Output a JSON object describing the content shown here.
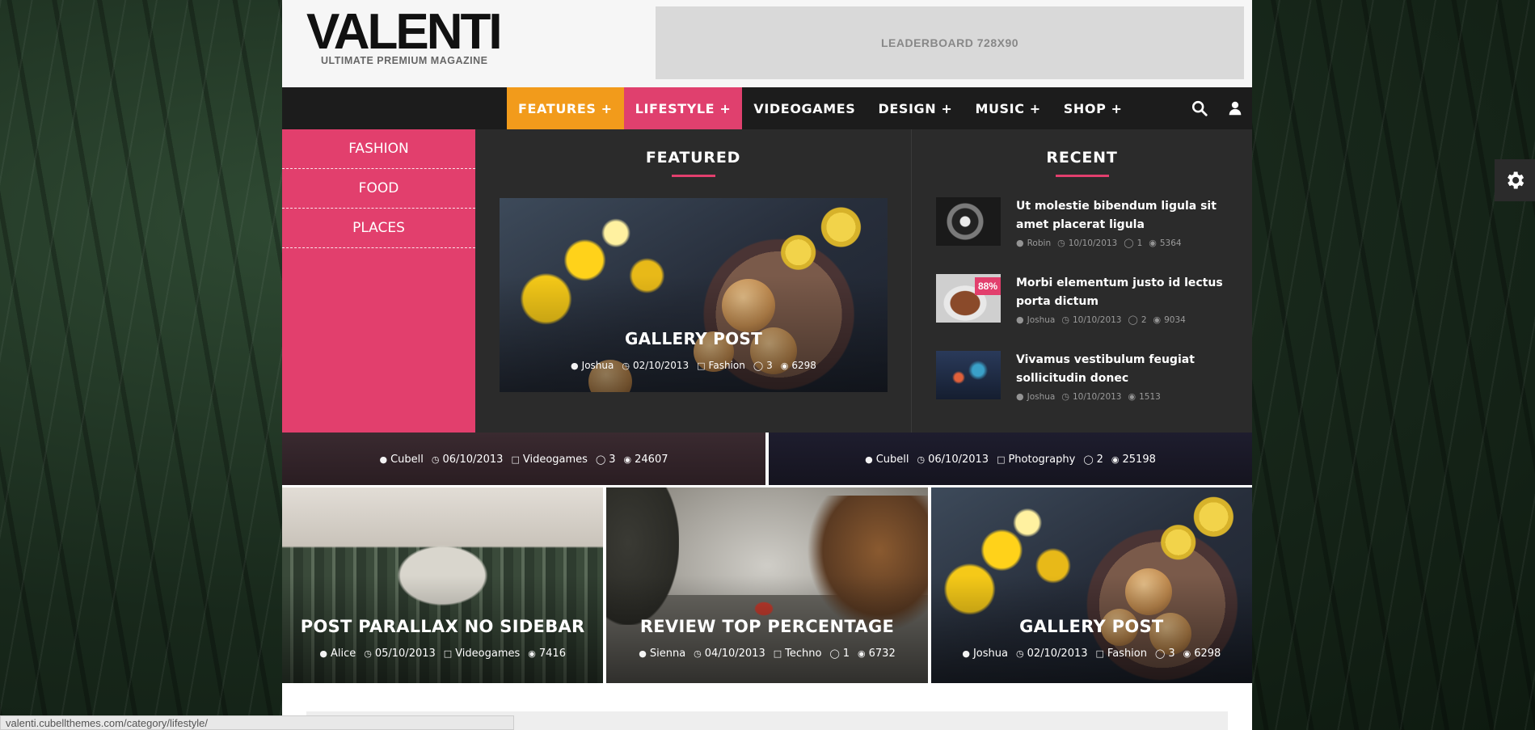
{
  "header": {
    "logo_title": "VALENTI",
    "logo_tagline": "ULTIMATE PREMIUM MAGAZINE",
    "leaderboard": "LEADERBOARD 728X90"
  },
  "nav": {
    "items": [
      {
        "label": "FEATURES +"
      },
      {
        "label": "LIFESTYLE +"
      },
      {
        "label": "VIDEOGAMES"
      },
      {
        "label": "DESIGN +"
      },
      {
        "label": "MUSIC +"
      },
      {
        "label": "SHOP +"
      }
    ],
    "icons": [
      "search-icon",
      "user-icon"
    ],
    "colors": {
      "features": "#f29b1b",
      "lifestyle": "#e0406e",
      "bar": "#1c1c1c"
    }
  },
  "mega_menu": {
    "sub_items": [
      {
        "label": "FASHION"
      },
      {
        "label": "FOOD"
      },
      {
        "label": "PLACES"
      }
    ],
    "featured": {
      "heading": "FEATURED",
      "title": "GALLERY POST",
      "author": "Joshua",
      "date": "02/10/2013",
      "category": "Fashion",
      "comments": "3",
      "views": "6298"
    },
    "recent": {
      "heading": "RECENT",
      "items": [
        {
          "title": "Ut molestie bibendum ligula sit amet placerat ligula",
          "author": "Robin",
          "date": "10/10/2013",
          "comments": "1",
          "views": "5364"
        },
        {
          "title": "Morbi elementum justo id lectus porta dictum",
          "author": "Joshua",
          "date": "10/10/2013",
          "comments": "2",
          "views": "9034",
          "badge": "88%"
        },
        {
          "title": "Vivamus vestibulum feugiat sollicitudin donec",
          "author": "Joshua",
          "date": "10/10/2013",
          "views": "1513"
        }
      ]
    }
  },
  "grid": {
    "row1": [
      {
        "author": "Cubell",
        "date": "06/10/2013",
        "category": "Videogames",
        "comments": "3",
        "views": "24607"
      },
      {
        "author": "Cubell",
        "date": "06/10/2013",
        "category": "Photography",
        "comments": "2",
        "views": "25198"
      }
    ],
    "row2": [
      {
        "title": "POST PARALLAX NO SIDEBAR",
        "author": "Alice",
        "date": "05/10/2013",
        "category": "Videogames",
        "views": "7416"
      },
      {
        "title": "REVIEW TOP PERCENTAGE",
        "author": "Sienna",
        "date": "04/10/2013",
        "category": "Techno",
        "comments": "1",
        "views": "6732"
      },
      {
        "title": "GALLERY POST",
        "author": "Joshua",
        "date": "02/10/2013",
        "category": "Fashion",
        "comments": "3",
        "views": "6298"
      }
    ]
  },
  "status_bar": {
    "url": "valenti.cubellthemes.com/category/lifestyle/"
  },
  "settings_icon": "gear-icon"
}
